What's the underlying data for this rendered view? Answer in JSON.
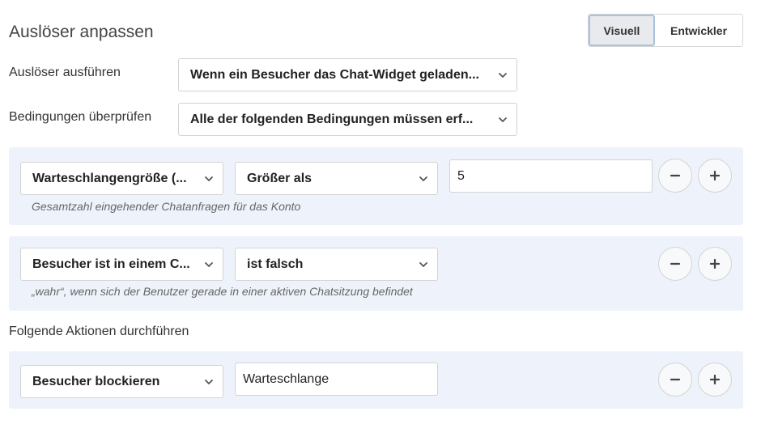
{
  "header": {
    "title": "Auslöser anpassen",
    "mode_visual": "Visuell",
    "mode_developer": "Entwickler"
  },
  "trigger": {
    "run_label": "Auslöser ausführen",
    "run_value": "Wenn ein Besucher das Chat-Widget geladen...",
    "check_label": "Bedingungen überprüfen",
    "check_value": "Alle der folgenden Bedingungen müssen erf..."
  },
  "conditions": [
    {
      "field": "Warteschlangengröße (...",
      "operator": "Größer als",
      "value": "5",
      "hint": "Gesamtzahl eingehender Chatanfragen für das Konto"
    },
    {
      "field": "Besucher ist in einem C...",
      "operator": "ist falsch",
      "hint": "„wahr“, wenn sich der Benutzer gerade in einer aktiven Chatsitzung befindet"
    }
  ],
  "actions": {
    "label": "Folgende Aktionen durchführen",
    "items": [
      {
        "action": "Besucher blockieren",
        "value": "Warteschlange"
      }
    ]
  },
  "icons": {
    "chevron": "chevron-down-icon",
    "minus": "minus-icon",
    "plus": "plus-icon"
  },
  "colors": {
    "panel_bg": "#eef3fb",
    "visual_active_border": "#a9c2de"
  }
}
